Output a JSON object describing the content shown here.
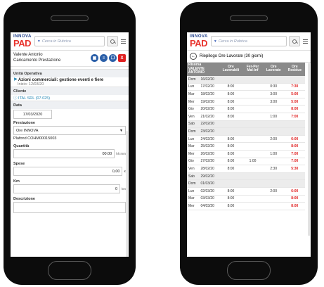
{
  "app": {
    "logo_top": "INNOVA",
    "logo_bottom": "PAD",
    "search_placeholder": "Cerca in Rubrica"
  },
  "left": {
    "header": {
      "name": "Valente Antonio",
      "subtitle": "Caricamento Prestazione"
    },
    "actions": [
      {
        "icon": "save-icon",
        "color": "#2b5fa8"
      },
      {
        "icon": "list-icon",
        "color": "#2b5fa8"
      },
      {
        "icon": "copy-icon",
        "color": "#2b5fa8"
      },
      {
        "icon": "delete-icon",
        "color": "#e02020",
        "glyph": "X"
      }
    ],
    "unita_label": "Unità Operativa",
    "unita_value": "Azioni commerciali: gestione eventi e fiere",
    "unita_start": "Inizio: 12/03/20",
    "cliente_label": "Cliente",
    "cliente_value": "ITAL SRL (07.025)",
    "data_label": "Data",
    "data_value": "17/03/2020",
    "prestazione_label": "Prestazione",
    "prestazione_value": "Ore INNOVA",
    "plafond": "Plafond COHM00015003",
    "quantita_label": "Quantità",
    "quantita_value": "00:00",
    "quantita_unit": "hh:mm",
    "spese_label": "Spese",
    "spese_value": "0,00",
    "spese_unit": "€",
    "km_label": "Km",
    "km_value": "0",
    "km_unit": "km",
    "descrizione_label": "Descrizione"
  },
  "right": {
    "title": "Riepilogo Ore Lavorate (30 giorni)",
    "headers": {
      "risorsa": "Risorsa",
      "risorsa_name": "VALENTE ANTONIO",
      "ore_lav": "Ore Lavorabili",
      "perm": "Fer-Per Mal-Inf",
      "ore_lavorate": "Ore Lavorate",
      "residue": "Ore Residue"
    },
    "rows": [
      {
        "day": "Dom",
        "date": "16/02/20",
        "lav": "",
        "per": "",
        "done": "",
        "res": ""
      },
      {
        "day": "Lun",
        "date": "17/02/20",
        "lav": "8:00",
        "per": "",
        "done": "0:30",
        "res": "7:30"
      },
      {
        "day": "Mar",
        "date": "18/02/20",
        "lav": "8:00",
        "per": "",
        "done": "3:00",
        "res": "5:00"
      },
      {
        "day": "Mer",
        "date": "19/02/20",
        "lav": "8:00",
        "per": "",
        "done": "3:00",
        "res": "5:00"
      },
      {
        "day": "Gio",
        "date": "20/02/20",
        "lav": "8:00",
        "per": "",
        "done": "",
        "res": "8:00"
      },
      {
        "day": "Ven",
        "date": "21/02/20",
        "lav": "8:00",
        "per": "",
        "done": "1:00",
        "res": "7:00"
      },
      {
        "day": "Sab",
        "date": "22/02/20",
        "lav": "",
        "per": "",
        "done": "",
        "res": ""
      },
      {
        "day": "Dom",
        "date": "23/02/20",
        "lav": "",
        "per": "",
        "done": "",
        "res": ""
      },
      {
        "day": "Lun",
        "date": "24/02/20",
        "lav": "8:00",
        "per": "",
        "done": "2:00",
        "res": "6:00"
      },
      {
        "day": "Mar",
        "date": "25/02/20",
        "lav": "8:00",
        "per": "",
        "done": "",
        "res": "8:00"
      },
      {
        "day": "Mer",
        "date": "26/02/20",
        "lav": "8:00",
        "per": "",
        "done": "1:00",
        "res": "7:00"
      },
      {
        "day": "Gio",
        "date": "27/02/20",
        "lav": "8:00",
        "per": "1:00",
        "done": "",
        "res": "7:00"
      },
      {
        "day": "Ven",
        "date": "28/02/20",
        "lav": "8:00",
        "per": "",
        "done": "2:30",
        "res": "5:30"
      },
      {
        "day": "Sab",
        "date": "29/02/20",
        "lav": "",
        "per": "",
        "done": "",
        "res": ""
      },
      {
        "day": "Dom",
        "date": "01/03/20",
        "lav": "",
        "per": "",
        "done": "",
        "res": ""
      },
      {
        "day": "Lun",
        "date": "02/03/20",
        "lav": "8:00",
        "per": "",
        "done": "2:00",
        "res": "6:00"
      },
      {
        "day": "Mar",
        "date": "03/03/20",
        "lav": "8:00",
        "per": "",
        "done": "",
        "res": "8:00"
      },
      {
        "day": "Mer",
        "date": "04/03/20",
        "lav": "8:00",
        "per": "",
        "done": "",
        "res": "8:00"
      }
    ]
  }
}
